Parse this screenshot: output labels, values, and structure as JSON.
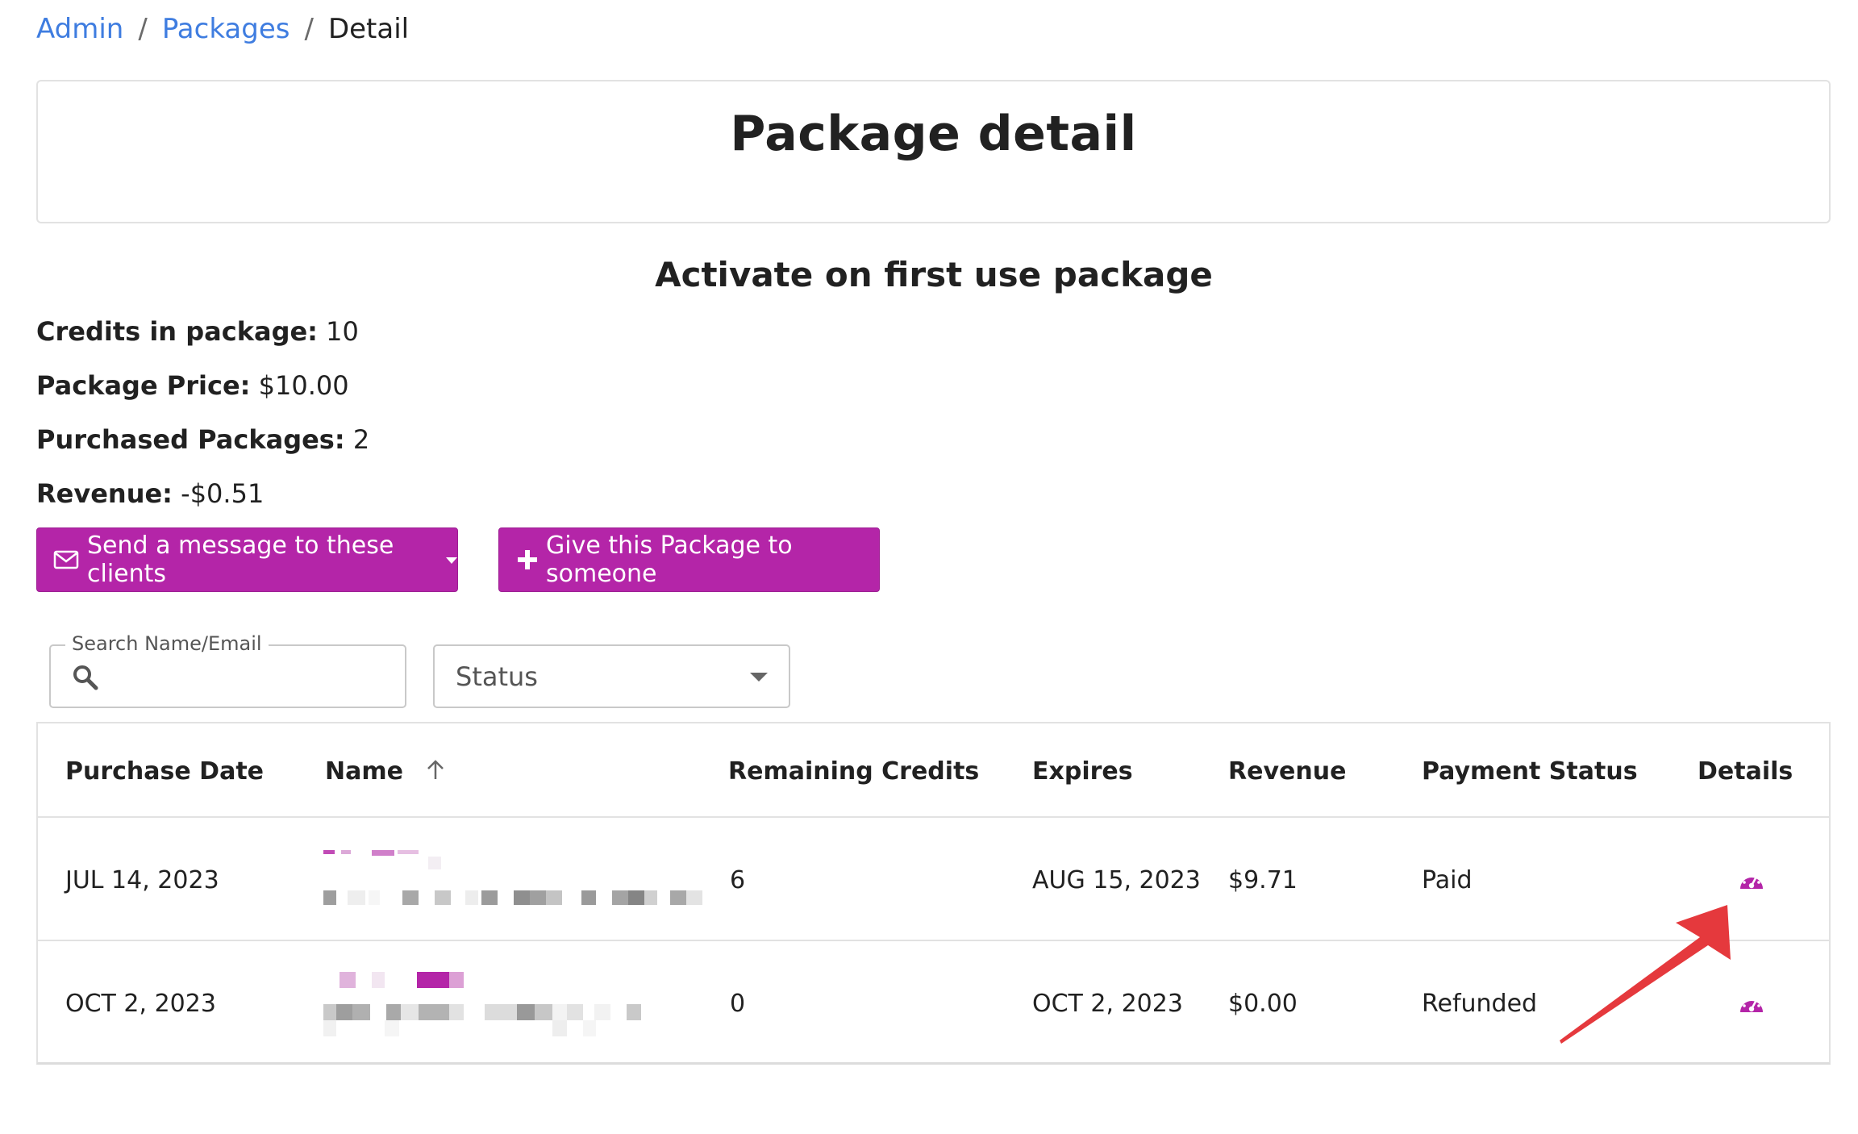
{
  "breadcrumb": {
    "items": [
      "Admin",
      "Packages"
    ],
    "current": "Detail",
    "separator": "/"
  },
  "page_title": "Package detail",
  "package_name": "Activate on first use package",
  "stats": {
    "credits_label": "Credits in package:",
    "credits_value": "10",
    "price_label": "Package Price:",
    "price_value": "$10.00",
    "purchased_label": "Purchased Packages:",
    "purchased_value": "2",
    "revenue_label": "Revenue:",
    "revenue_value": "-$0.51"
  },
  "actions": {
    "message_label": "Send a message to these clients",
    "give_label": "Give this Package to someone"
  },
  "filters": {
    "search_label": "Search Name/Email",
    "search_value": "",
    "status_placeholder": "Status"
  },
  "table": {
    "headers": [
      "Purchase Date",
      "Name",
      "Remaining Credits",
      "Expires",
      "Revenue",
      "Payment Status",
      "Details"
    ],
    "rows": [
      {
        "purchase_date": "JUL 14, 2023",
        "remaining": "6",
        "expires": "AUG 15, 2023",
        "revenue": "$9.71",
        "status": "Paid"
      },
      {
        "purchase_date": "OCT 2, 2023",
        "remaining": "0",
        "expires": "OCT 2, 2023",
        "revenue": "$0.00",
        "status": "Refunded"
      }
    ]
  },
  "colors": {
    "primary": "#b425a8",
    "link": "#3f7de0",
    "annotation": "#e5393d"
  },
  "icons": [
    "envelope-icon",
    "plus-icon",
    "search-icon",
    "sort-up-icon",
    "speedometer-icon",
    "annotation-arrow"
  ]
}
